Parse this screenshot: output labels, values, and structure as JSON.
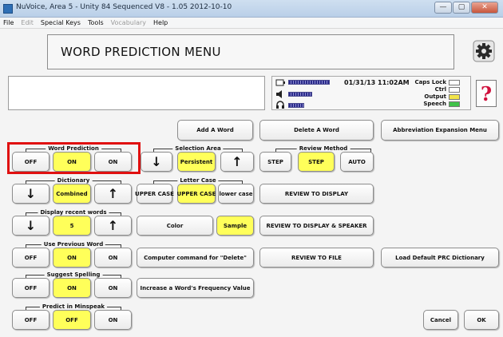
{
  "window": {
    "title": "NuVoice, Area 5 - Unity 84 Sequenced V8 - 1.05 2012-10-10",
    "buttons": {
      "minimize": "—",
      "maximize": "▢",
      "close": "✕"
    }
  },
  "menubar": [
    {
      "label": "File",
      "enabled": true
    },
    {
      "label": "Edit",
      "enabled": false
    },
    {
      "label": "Special Keys",
      "enabled": true
    },
    {
      "label": "Tools",
      "enabled": true
    },
    {
      "label": "Vocabulary",
      "enabled": false
    },
    {
      "label": "Help",
      "enabled": true
    }
  ],
  "heading": "WORD PREDICTION MENU",
  "status": {
    "datetime": "01/31/13 11:02AM",
    "indicators": [
      {
        "label": "Caps Lock",
        "color": "#ffffff"
      },
      {
        "label": "Ctrl",
        "color": "#ffffff"
      },
      {
        "label": "Output",
        "color": "#f2e44a"
      },
      {
        "label": "Speech",
        "color": "#41c24a"
      }
    ]
  },
  "help_label": "?",
  "actions": {
    "add_word": "Add A Word",
    "delete_word": "Delete A Word",
    "abbreviation": "Abbreviation Expansion Menu",
    "color": "Color",
    "sample": "Sample",
    "computer_command": "Computer command for \"Delete\"",
    "increase_frequency": "Increase a Word's Frequency Value",
    "review_display": "REVIEW TO DISPLAY",
    "review_display_speaker": "REVIEW TO DISPLAY & SPEAKER",
    "review_file": "REVIEW TO FILE",
    "load_default": "Load Default PRC Dictionary",
    "cancel": "Cancel",
    "ok": "OK"
  },
  "groups": {
    "word_prediction": {
      "label": "Word Prediction",
      "off": "OFF",
      "value": "ON",
      "on": "ON"
    },
    "dictionary": {
      "label": "Dictionary",
      "value": "Combined",
      "down": "↓",
      "up": "↑"
    },
    "display_recent": {
      "label": "Display recent words",
      "value": "5",
      "down": "↓",
      "up": "↑"
    },
    "use_previous": {
      "label": "Use Previous Word",
      "off": "OFF",
      "value": "ON",
      "on": "ON"
    },
    "suggest_spelling": {
      "label": "Suggest Spelling",
      "off": "OFF",
      "value": "ON",
      "on": "ON"
    },
    "predict_minspeak": {
      "label": "Predict in Minspeak",
      "off": "OFF",
      "value": "OFF",
      "on": "ON"
    },
    "selection_area": {
      "label": "Selection Area",
      "value": "Persistent",
      "down": "↓",
      "up": "↑"
    },
    "letter_case": {
      "label": "Letter Case",
      "upper": "UPPER CASE",
      "value": "UPPER CASE",
      "lower": "lower case"
    },
    "review_method": {
      "label": "Review Method",
      "step": "STEP",
      "value": "STEP",
      "auto": "AUTO"
    }
  },
  "colors": {
    "selected": "#ffff5a",
    "highlight": "#e01010",
    "help": "#d0103c"
  }
}
